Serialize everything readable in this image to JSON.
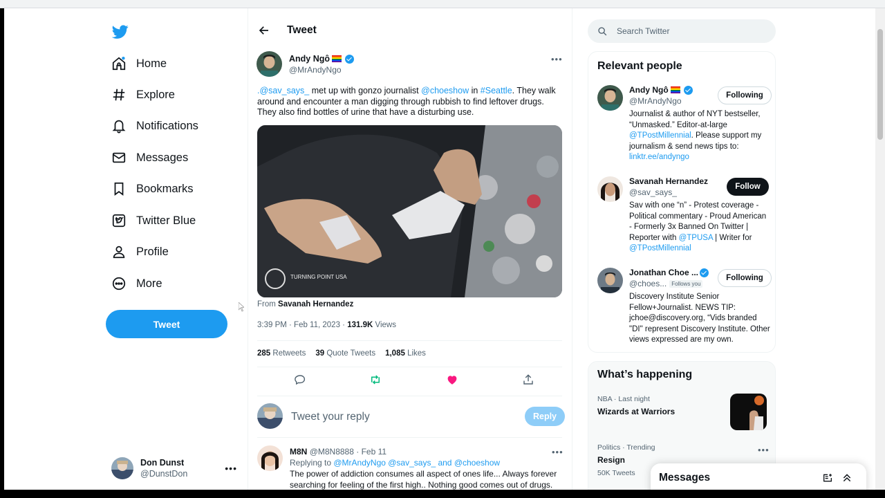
{
  "nav": {
    "items": [
      {
        "label": "Home",
        "icon": "home-icon"
      },
      {
        "label": "Explore",
        "icon": "hashtag-icon"
      },
      {
        "label": "Notifications",
        "icon": "bell-icon"
      },
      {
        "label": "Messages",
        "icon": "envelope-icon"
      },
      {
        "label": "Bookmarks",
        "icon": "bookmark-icon"
      },
      {
        "label": "Twitter Blue",
        "icon": "twitter-blue-icon"
      },
      {
        "label": "Profile",
        "icon": "person-icon"
      },
      {
        "label": "More",
        "icon": "more-circle-icon"
      }
    ],
    "tweet_button": "Tweet",
    "account": {
      "name": "Don Dunst",
      "handle": "@DunstDon"
    }
  },
  "main": {
    "title": "Tweet",
    "author": {
      "name": "Andy Ngô",
      "handle": "@MrAndyNgo"
    },
    "text": {
      "mention1": ".@sav_says_",
      "part1": " met up with gonzo journalist ",
      "mention2": "@choeshow",
      "part2": " in ",
      "hashtag": "#Seattle",
      "part3": ". They walk around and encounter a man digging through rubbish to find leftover drugs. They also find bottles of urine that have a disturbing use."
    },
    "media_watermark": "TURNING POINT USA",
    "from_prefix": "From ",
    "from_name": "Savanah Hernandez",
    "time": "3:39 PM · Feb 11, 2023 · ",
    "views_count": "131.9K",
    "views_label": " Views",
    "stats": {
      "retweets_count": "285",
      "retweets_label": "Retweets",
      "quotes_count": "39",
      "quotes_label": "Quote Tweets",
      "likes_count": "1,085",
      "likes_label": "Likes"
    },
    "reply_placeholder": "Tweet your reply",
    "reply_button": "Reply",
    "reply": {
      "name": "M8N",
      "handle_date": "@M8N8888 · Feb 11",
      "replying_prefix": "Replying to ",
      "replying_to": "@MrAndyNgo @sav_says_ and @choeshow",
      "body": "The power of addiction consumes all aspect of ones life... Always forever searching for feeling of the first high.. Nothing good comes out of drugs."
    }
  },
  "sidebar": {
    "search_placeholder": "Search Twitter",
    "relevant_title": "Relevant people",
    "people": [
      {
        "name": "Andy Ngô",
        "handle": "@MrAndyNgo",
        "button": "Following",
        "bio_1": "Journalist & author of NYT bestseller, “Unmasked.” Editor-at-large ",
        "bio_link1": "@TPostMillennial",
        "bio_2": ". Please support my journalism & send news tips to: ",
        "bio_link2": "linktr.ee/andyngo"
      },
      {
        "name": "Savanah Hernandez",
        "handle": "@sav_says_",
        "button": "Follow",
        "bio_1": "Sav with one “n” - Protest coverage - Political commentary - Proud American - Formerly 3x Banned On Twitter | Reporter with ",
        "bio_link1": "@TPUSA",
        "bio_2": " | Writer for ",
        "bio_link2": "@TPostMillennial"
      },
      {
        "name": "Jonathan Choe ...",
        "handle": "@choes...",
        "follows_you": "Follows you",
        "button": "Following",
        "bio": "Discovery Institute Senior Fellow+Journalist. NEWS TIP: jchoe@discovery.org, “Vids branded \"DI\" represent Discovery Institute. Other views expressed are my own."
      }
    ],
    "happening_title": "What’s happening",
    "trends": [
      {
        "meta": "NBA · Last night",
        "title": "Wizards at Warriors"
      },
      {
        "meta": "Politics · Trending",
        "title": "Resign",
        "count": "50K Tweets"
      }
    ],
    "messages_title": "Messages"
  },
  "colors": {
    "accent": "#1d9bf0",
    "like": "#f91880",
    "retweet": "#00ba7c"
  }
}
